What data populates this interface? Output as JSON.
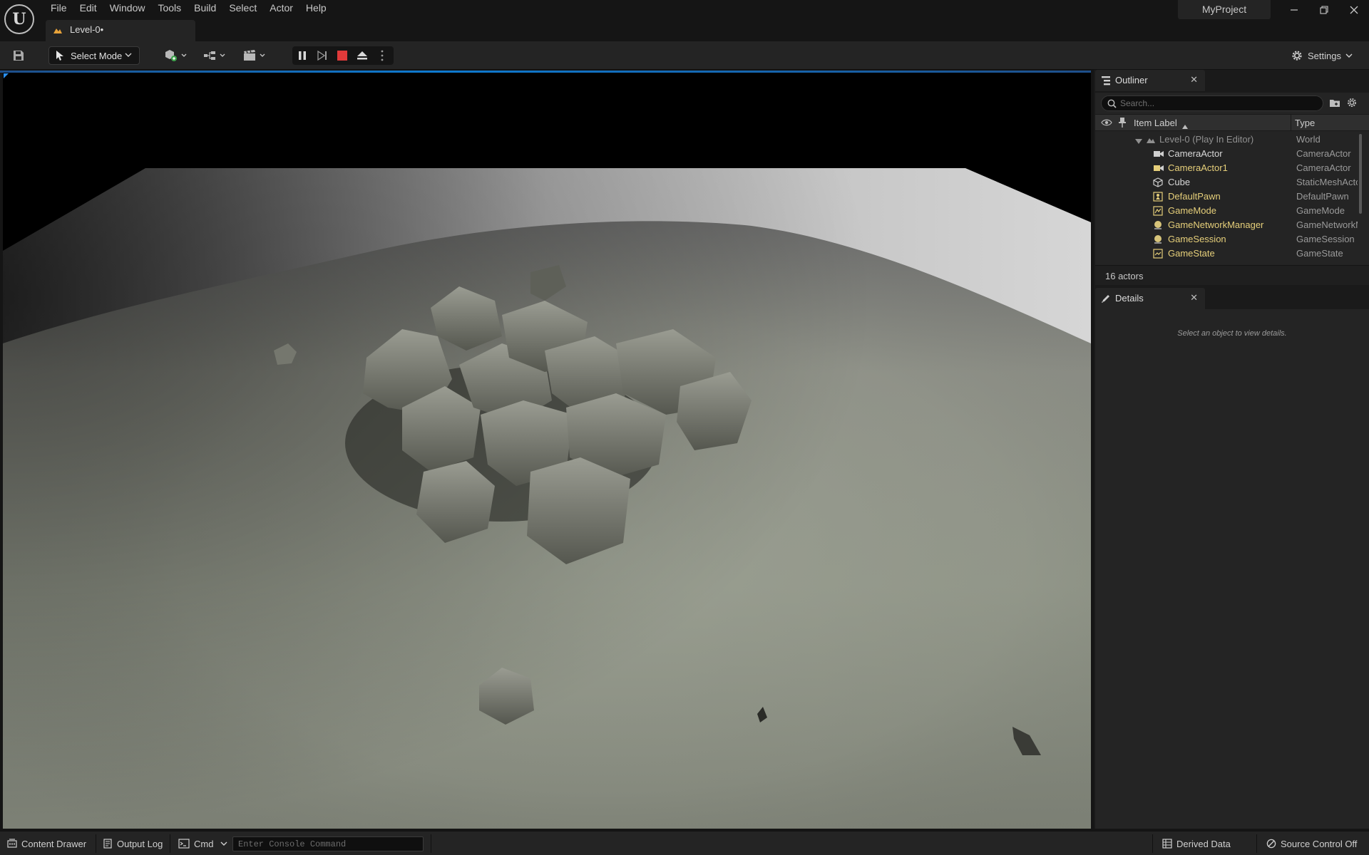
{
  "menu": [
    "File",
    "Edit",
    "Window",
    "Tools",
    "Build",
    "Select",
    "Actor",
    "Help"
  ],
  "project_name": "MyProject",
  "level_tab": "Level-0•",
  "toolbar": {
    "select_mode": "Select Mode",
    "settings": "Settings"
  },
  "outliner": {
    "tab_label": "Outliner",
    "search_placeholder": "Search...",
    "col_label": "Item Label",
    "col_type": "Type",
    "rows": [
      {
        "name": "Level-0 (Play In Editor)",
        "type": "World",
        "icon": "world-icon"
      },
      {
        "name": "CameraActor",
        "type": "CameraActor",
        "icon": "camera-icon"
      },
      {
        "name": "CameraActor1",
        "type": "CameraActor",
        "icon": "camera-icon"
      },
      {
        "name": "Cube",
        "type": "StaticMeshActor",
        "icon": "cube-icon"
      },
      {
        "name": "DefaultPawn",
        "type": "DefaultPawn",
        "icon": "pawn-icon"
      },
      {
        "name": "GameMode",
        "type": "GameMode",
        "icon": "gamemode-icon"
      },
      {
        "name": "GameNetworkManager",
        "type": "GameNetworkManager",
        "icon": "manager-icon"
      },
      {
        "name": "GameSession",
        "type": "GameSession",
        "icon": "manager-icon"
      },
      {
        "name": "GameState",
        "type": "GameState",
        "icon": "gamestate-icon"
      }
    ],
    "actor_count": "16 actors"
  },
  "details": {
    "tab_label": "Details",
    "empty_text": "Select an object to view details."
  },
  "statusbar": {
    "content_drawer": "Content Drawer",
    "output_log": "Output Log",
    "cmd": "Cmd",
    "console_placeholder": "Enter Console Command",
    "derived_data": "Derived Data",
    "source_control": "Source Control Off"
  },
  "colors": {
    "accent_blue": "#0e7ad0",
    "stop_red": "#e03a3a",
    "actor_yellow": "#e6cf7a"
  }
}
